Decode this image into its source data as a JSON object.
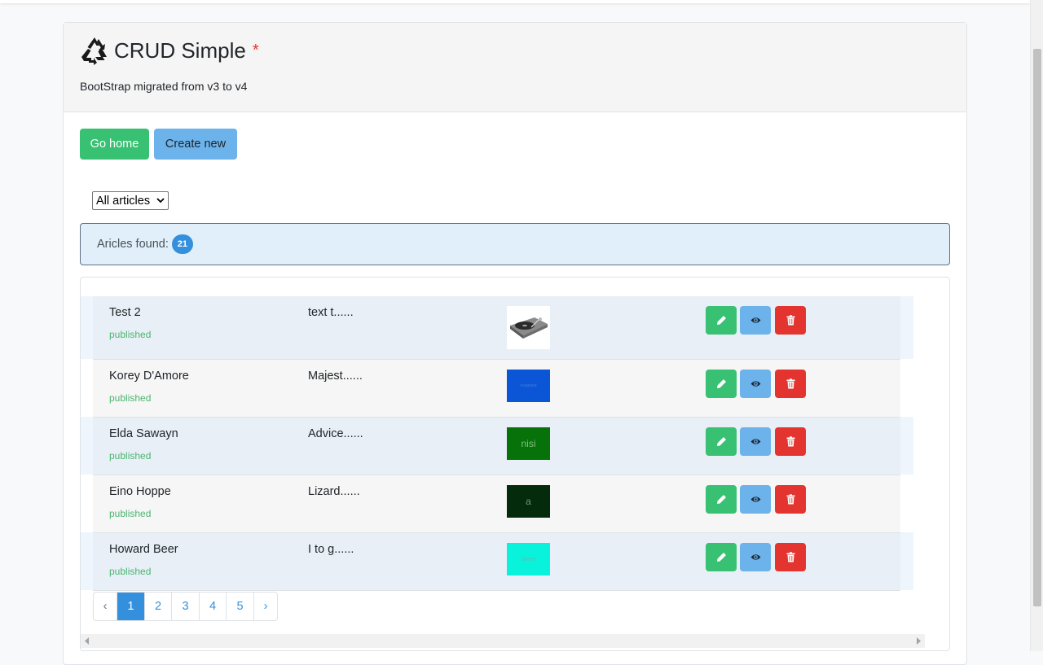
{
  "header": {
    "title": "CRUD Simple",
    "asterisk": "*",
    "subtitle": "BootStrap migrated from v3 to v4"
  },
  "toolbar": {
    "home_label": "Go home",
    "create_label": "Create new"
  },
  "filter": {
    "selected": "All articles"
  },
  "alert": {
    "label": "Aricles found:",
    "count": "21"
  },
  "articles": [
    {
      "name": "Test 2",
      "status": "published",
      "text": "text t......",
      "thumb_color": "#ffffff",
      "thumb_text": ""
    },
    {
      "name": "Korey D'Amore",
      "status": "published",
      "text": "Majest......",
      "thumb_color": "#0b56d6",
      "thumb_text": "voluptate"
    },
    {
      "name": "Elda Sawayn",
      "status": "published",
      "text": "Advice......",
      "thumb_color": "#08720a",
      "thumb_text": "nisi"
    },
    {
      "name": "Eino Hoppe",
      "status": "published",
      "text": "Lizard......",
      "thumb_color": "#042c0c",
      "thumb_text": "a"
    },
    {
      "name": "Howard Beer",
      "status": "published",
      "text": "I to g......",
      "thumb_color": "#09f2dc",
      "thumb_text": "libero"
    }
  ],
  "pagination": {
    "prev": "‹",
    "pages": [
      "1",
      "2",
      "3",
      "4",
      "5"
    ],
    "next": "›",
    "active": "1"
  },
  "colors": {
    "success": "#38c172",
    "info": "#6cb2eb",
    "danger": "#e3342f",
    "primary": "#3490dc"
  }
}
